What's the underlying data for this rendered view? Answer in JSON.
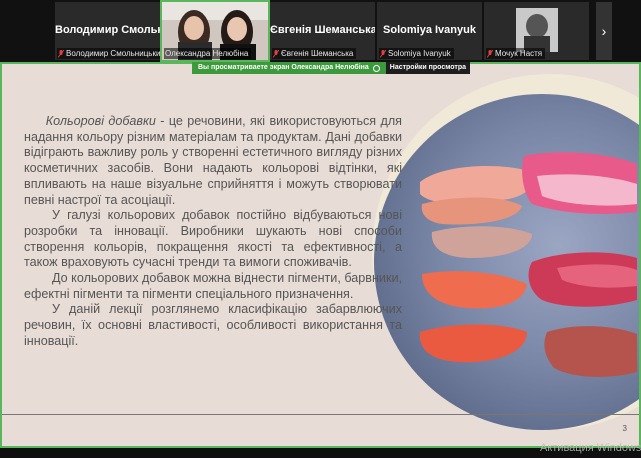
{
  "participants": [
    {
      "big": "Володимир Смольницький",
      "caption": "Володимир Смольницький",
      "muted": true
    },
    {
      "big": "",
      "caption": "Олександра Нелюбіна",
      "muted": false,
      "active": true
    },
    {
      "big": "Євгенія Шеманська",
      "caption": "Євгенія Шеманська",
      "muted": true
    },
    {
      "big": "Solomiya Ivanyuk",
      "caption": "Solomiya Ivanyuk",
      "muted": true
    },
    {
      "big": "",
      "caption": "Мочук Настя",
      "muted": true
    }
  ],
  "next_icon": "chevron-right-icon",
  "view_bar": {
    "message": "Вы просматриваете экран Олександра Нелюбіна",
    "options": "Настройки просмотра"
  },
  "slide": {
    "term": "Кольорові добавки",
    "p1": " - це речовини, які використовуються для надання кольору різним матеріалам та продуктам. Дані добавки відіграють важливу роль у створенні естетичного вигляду різних косметичних засобів. Вони надають кольорові відтінки, які впливають на наше візуальне сприйняття і можуть створювати певні настрої та асоціації.",
    "p2": "У галузі кольорових добавок постійно відбуваються нові розробки та інновації. Виробники шукають нові способи створення кольорів, покращення якості та ефективності, а також враховують сучасні тренди та вимоги споживачів.",
    "p3": "До кольорових добавок можна віднести пігменти, барвники, ефектні пігменти та пігменти спеціального призначення.",
    "p4": "У даній лекції розглянемо класифікацію забарвлюючих речовин, їх основні властивості, особливості використання та інновації.",
    "page": "3"
  },
  "watermark": "Активация Windows",
  "colors": {
    "accent_green": "#5ab65a",
    "slide_bg": "#e8dcd6",
    "text": "#555555"
  }
}
